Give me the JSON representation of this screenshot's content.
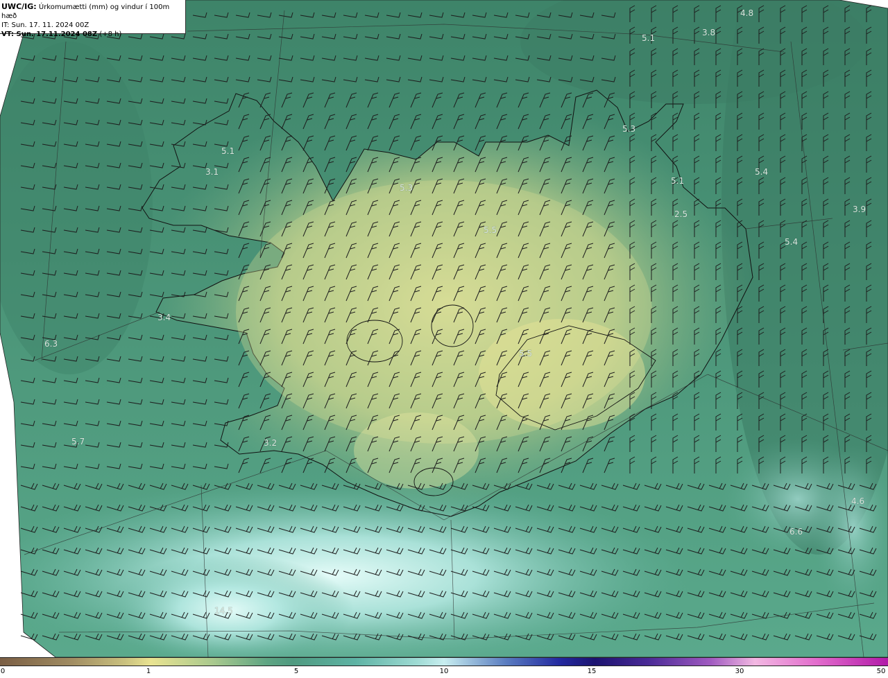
{
  "header": {
    "model": "UWC/IG:",
    "field": "Úrkomumætti (mm) og vindur í 100m hæð",
    "it_line": "IT: Sun. 17. 11. 2024 00Z",
    "vt_label": "VT: Sun. 17.11.2024 08Z",
    "vt_offset": "(+8 h)"
  },
  "colorbar": {
    "ticks": [
      "0",
      "1",
      "5",
      "10",
      "15",
      "30",
      "50"
    ]
  },
  "map": {
    "value_labels": [
      "4.8",
      "5.1",
      "3.8",
      "5.3",
      "5.1",
      "3.1",
      "5.3",
      "5.4",
      "5.1",
      "3.9",
      "5.5",
      "2.5",
      "5.4",
      "3.4",
      "6.3",
      "5.5",
      "5.7",
      "3.2",
      "4.6",
      "6.6",
      "14.5"
    ],
    "colors": {
      "sea_dark": "#3d8168",
      "sea_mid": "#4e9a7c",
      "land_light": "#cfd88e",
      "precip_cyan": "#b8ece6",
      "coast_line": "#111111",
      "barb": "#1d1d1d"
    }
  }
}
